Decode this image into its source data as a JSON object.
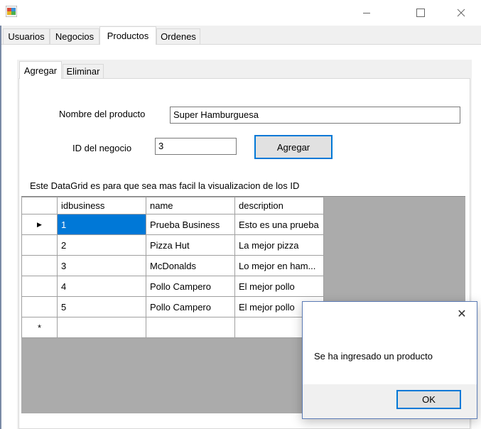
{
  "window": {
    "icon": "winforms-app-icon",
    "minimize_icon": "minimize-icon",
    "maximize_icon": "maximize-icon",
    "close_icon": "close-icon"
  },
  "main_tabs": [
    "Usuarios",
    "Negocios",
    "Productos",
    "Ordenes"
  ],
  "active_main_tab": "Productos",
  "sub_tabs": [
    "Agregar",
    "Eliminar"
  ],
  "active_sub_tab": "Agregar",
  "form": {
    "product_name_label": "Nombre del producto",
    "product_name_value": "Super Hamburguesa",
    "business_id_label": "ID del negocio",
    "business_id_value": "3",
    "add_button": "Agregar"
  },
  "grid": {
    "caption": "Este DataGrid es para que sea mas facil la visualizacion de los ID",
    "columns": [
      "idbusiness",
      "name",
      "description"
    ],
    "rows": [
      [
        "1",
        "Prueba Business",
        "Esto es una prueba"
      ],
      [
        "2",
        "Pizza Hut",
        "La mejor pizza"
      ],
      [
        "3",
        "McDonalds",
        "Lo mejor en ham..."
      ],
      [
        "4",
        "Pollo Campero",
        "El mejor pollo"
      ],
      [
        "5",
        "Pollo Campero",
        "El mejor pollo"
      ]
    ],
    "current_row_glyph": "▶",
    "new_row_glyph": "*"
  },
  "message_box": {
    "text": "Se ha ingresado un producto",
    "ok_button": "OK",
    "close_glyph": "✕"
  },
  "colors": {
    "selection": "#0078d7",
    "grid_background": "#ababab",
    "control_face": "#f0f0f0"
  }
}
